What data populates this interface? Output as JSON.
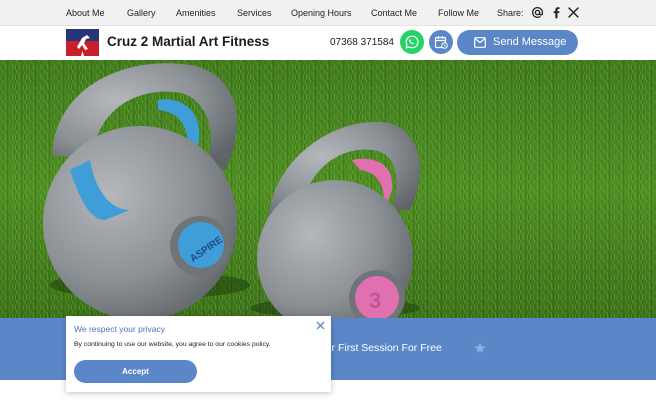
{
  "nav": {
    "items": [
      "About Me",
      "Gallery",
      "Amenities",
      "Services",
      "Opening Hours",
      "Contact Me",
      "Follow Me"
    ],
    "share_label": "Share:",
    "share_icons": [
      "email-at-icon",
      "facebook-icon",
      "x-twitter-icon"
    ]
  },
  "header": {
    "brand": "Cruz 2 Martial Art Fitness",
    "phone": "07368 371584",
    "whatsapp_icon": "whatsapp-icon",
    "calendar_icon": "calendar-icon",
    "message_button": "Send Message"
  },
  "hero": {
    "image": "two kettlebells on grass",
    "blue_bell_text": "ASPIRE",
    "pink_bell_text": "3"
  },
  "band": {
    "cta_partial": "ok Your First Session For Free"
  },
  "cookie": {
    "title": "We respect your privacy",
    "body": "By continuing to use our website, you agree to our cookies policy.",
    "accept": "Accept"
  },
  "colors": {
    "accent": "#5b87c8",
    "whatsapp": "#25d366",
    "topnav_bg": "#f1f1f1"
  }
}
